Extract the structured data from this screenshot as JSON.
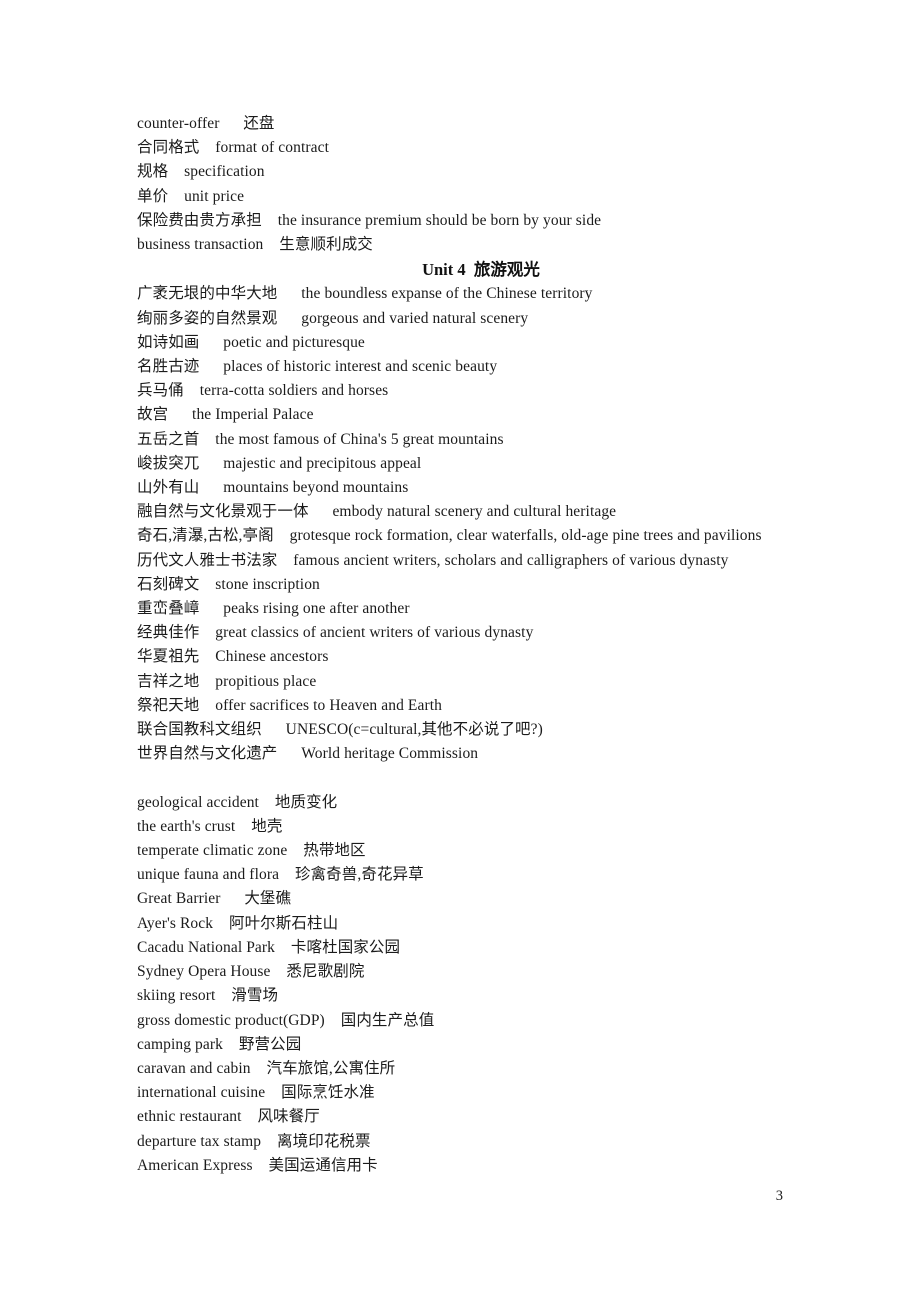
{
  "document": {
    "page_number": "3",
    "heading": "Unit 4  旅游观光",
    "section_business_lines": [
      "counter-offer      还盘",
      "合同格式    format of contract",
      "规格    specification",
      "单价    unit price",
      "保险费由贵方承担    the insurance premium should be born by your side",
      "business transaction    生意顺利成交"
    ],
    "section_tourism_lines": [
      "广袤无垠的中华大地      the boundless expanse of the Chinese territory",
      "绚丽多姿的自然景观      gorgeous and varied natural scenery",
      "如诗如画      poetic and picturesque",
      "名胜古迹      places of historic interest and scenic beauty",
      "兵马俑    terra-cotta soldiers and horses",
      "故宫      the Imperial Palace",
      "五岳之首    the most famous of China's 5 great mountains",
      "峻拔突兀      majestic and precipitous appeal",
      "山外有山      mountains beyond mountains",
      "融自然与文化景观于一体      embody natural scenery and cultural heritage",
      "奇石,清瀑,古松,亭阁    grotesque rock formation, clear waterfalls, old-age pine trees and pavilions",
      "历代文人雅士书法家    famous ancient writers, scholars and calligraphers of various dynasty",
      "石刻碑文    stone inscription",
      "重峦叠嶂      peaks rising one after another",
      "经典佳作    great classics of ancient writers of various dynasty",
      "华夏祖先    Chinese ancestors",
      "吉祥之地    propitious place",
      "祭祀天地    offer sacrifices to Heaven and Earth",
      "联合国教科文组织      UNESCO(c=cultural,其他不必说了吧?)",
      "世界自然与文化遗产      World heritage Commission"
    ],
    "section_geography_lines": [
      "geological accident    地质变化",
      "the earth's crust    地壳",
      "temperate climatic zone    热带地区",
      "unique fauna and flora    珍禽奇兽,奇花异草",
      "Great Barrier      大堡礁",
      "Ayer's Rock    阿叶尔斯石柱山",
      "Cacadu National Park    卡喀杜国家公园",
      "Sydney Opera House    悉尼歌剧院",
      "skiing resort    滑雪场",
      "gross domestic product(GDP)    国内生产总值",
      "camping park    野营公园",
      "caravan and cabin    汽车旅馆,公寓住所",
      "international cuisine    国际烹饪水准",
      "ethnic restaurant    风味餐厅",
      "departure tax stamp    离境印花税票",
      "American Express    美国运通信用卡"
    ]
  }
}
